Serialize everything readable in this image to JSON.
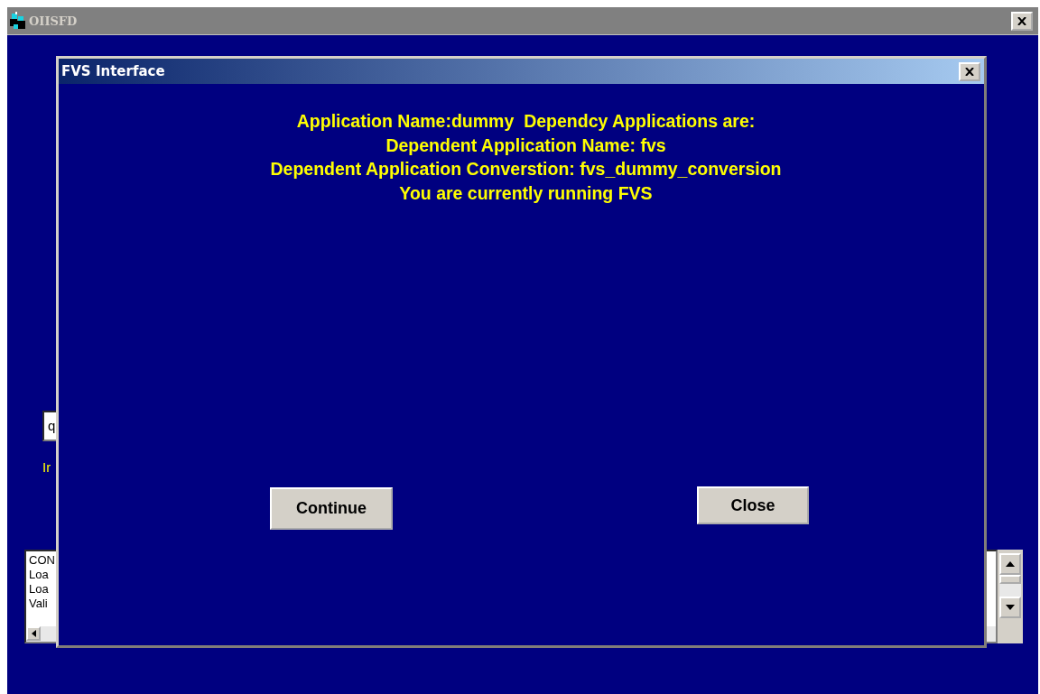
{
  "window": {
    "title": "OIISFD"
  },
  "background": {
    "field": {
      "value": "q"
    },
    "label": "Ir",
    "log": {
      "lines": [
        "CON",
        "Loa",
        "Loa",
        "Vali"
      ]
    }
  },
  "dialog": {
    "title": "FVS Interface",
    "lines": [
      "Application Name:dummy  Dependcy Applications are:",
      "Dependent Application Name: fvs",
      "Dependent Application Converstion: fvs_dummy_conversion",
      "You are currently running FVS"
    ],
    "buttons": [
      {
        "label": "Continue"
      },
      {
        "label": "Close"
      }
    ]
  }
}
